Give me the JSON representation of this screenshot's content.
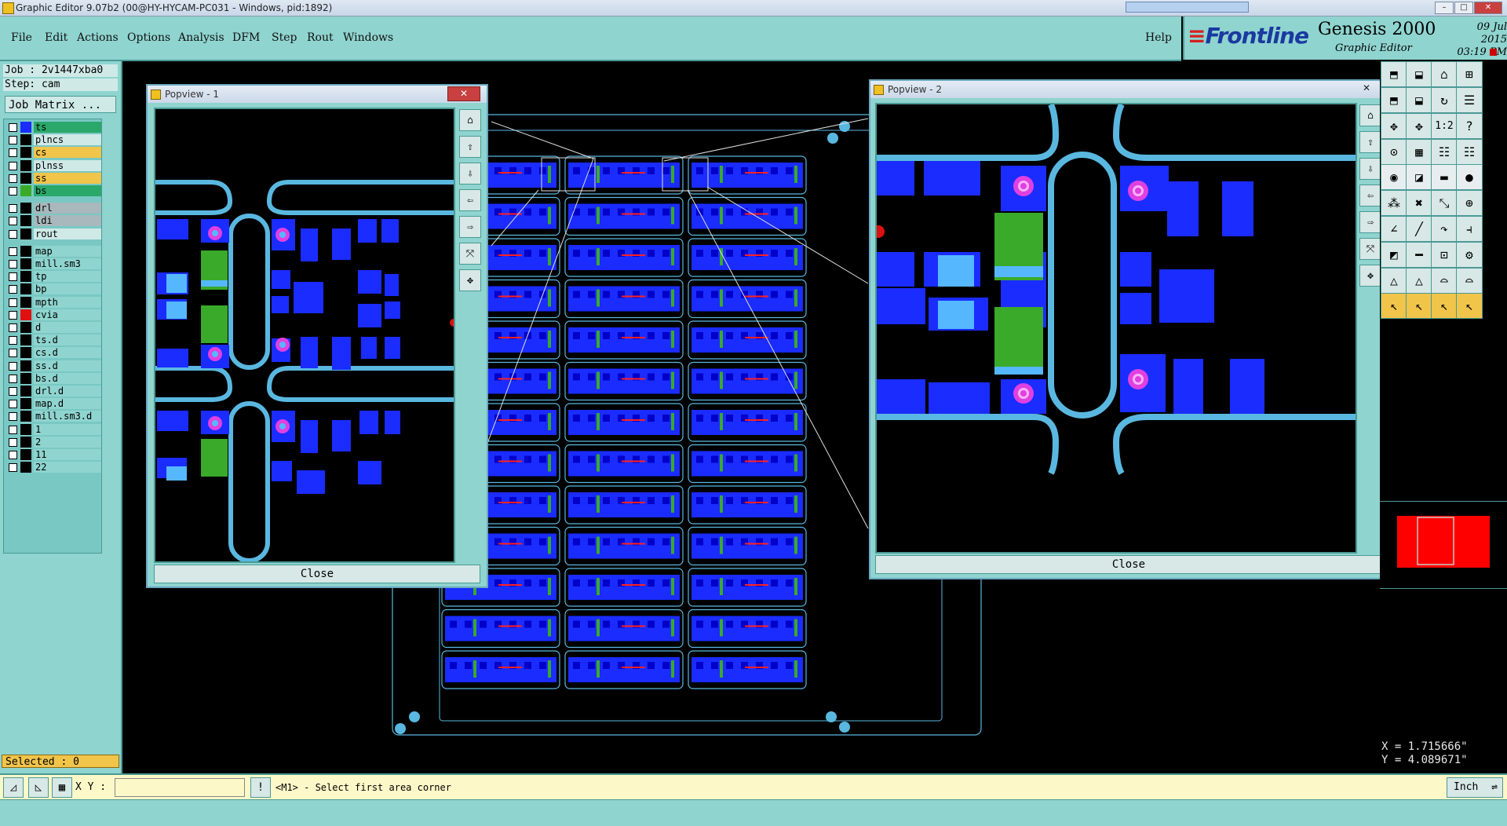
{
  "window": {
    "title": "Graphic Editor 9.07b2 (00@HY-HYCAM-PC031 - Windows, pid:1892)"
  },
  "menu": {
    "items": [
      "File",
      "Edit",
      "Actions",
      "Options",
      "Analysis",
      "DFM",
      "Step",
      "Rout",
      "Windows"
    ],
    "help": "Help"
  },
  "brand": {
    "logo": "Frontline",
    "product": "Genesis 2000",
    "subtitle": "Graphic Editor",
    "date": "09 Jul 2015",
    "time": "03:19 PM"
  },
  "job": {
    "job_line": "Job : 2v1447xba0",
    "step_line": "Step: cam",
    "matrix_button": "Job Matrix ..."
  },
  "layers": [
    {
      "name": "ts",
      "color": "#1a2cff",
      "bg": "#2aa86a"
    },
    {
      "name": "plncs",
      "color": "#000000",
      "bg": "#cfe9e7"
    },
    {
      "name": "cs",
      "color": "#000000",
      "bg": "#f1c44a"
    },
    {
      "name": "plnss",
      "color": "#000000",
      "bg": "#cfe9e7"
    },
    {
      "name": "ss",
      "color": "#000000",
      "bg": "#f1c44a"
    },
    {
      "name": "bs",
      "color": "#3aaa2a",
      "bg": "#2aa86a"
    },
    {
      "name": "drl",
      "color": "#000000",
      "bg": "#a8b8bc"
    },
    {
      "name": "ldi",
      "color": "#000000",
      "bg": "#a8b8bc"
    },
    {
      "name": "rout",
      "color": "#000000",
      "bg": "#cfe9e7"
    },
    {
      "name": "map",
      "color": "#000000",
      "bg": "#8fd4cf"
    },
    {
      "name": "mill.sm3",
      "color": "#000000",
      "bg": "#8fd4cf"
    },
    {
      "name": "tp",
      "color": "#000000",
      "bg": "#8fd4cf"
    },
    {
      "name": "bp",
      "color": "#000000",
      "bg": "#8fd4cf"
    },
    {
      "name": "mpth",
      "color": "#000000",
      "bg": "#8fd4cf"
    },
    {
      "name": "cvia",
      "color": "#e01010",
      "bg": "#8fd4cf"
    },
    {
      "name": "d",
      "color": "#000000",
      "bg": "#8fd4cf"
    },
    {
      "name": "ts.d",
      "color": "#000000",
      "bg": "#8fd4cf"
    },
    {
      "name": "cs.d",
      "color": "#000000",
      "bg": "#8fd4cf"
    },
    {
      "name": "ss.d",
      "color": "#000000",
      "bg": "#8fd4cf"
    },
    {
      "name": "bs.d",
      "color": "#000000",
      "bg": "#8fd4cf"
    },
    {
      "name": "drl.d",
      "color": "#000000",
      "bg": "#8fd4cf"
    },
    {
      "name": "map.d",
      "color": "#000000",
      "bg": "#8fd4cf"
    },
    {
      "name": "mill.sm3.d",
      "color": "#000000",
      "bg": "#8fd4cf"
    },
    {
      "name": "1",
      "color": "#000000",
      "bg": "#8fd4cf"
    },
    {
      "name": "2",
      "color": "#000000",
      "bg": "#8fd4cf"
    },
    {
      "name": "11",
      "color": "#000000",
      "bg": "#8fd4cf"
    },
    {
      "name": "22",
      "color": "#000000",
      "bg": "#8fd4cf"
    }
  ],
  "selected": "Selected : 0",
  "popview1": {
    "title": "Popview - 1",
    "close": "Close"
  },
  "popview2": {
    "title": "Popview - 2",
    "close": "Close"
  },
  "command": {
    "xy_label": "X Y :",
    "xy_value": "",
    "prompt": "<M1> - Select first area corner",
    "units": "Inch"
  },
  "coords": {
    "x": "X = 1.715666\"",
    "y": "Y = 4.089671\""
  },
  "right_tools": {
    "scale_label": "1:2"
  }
}
